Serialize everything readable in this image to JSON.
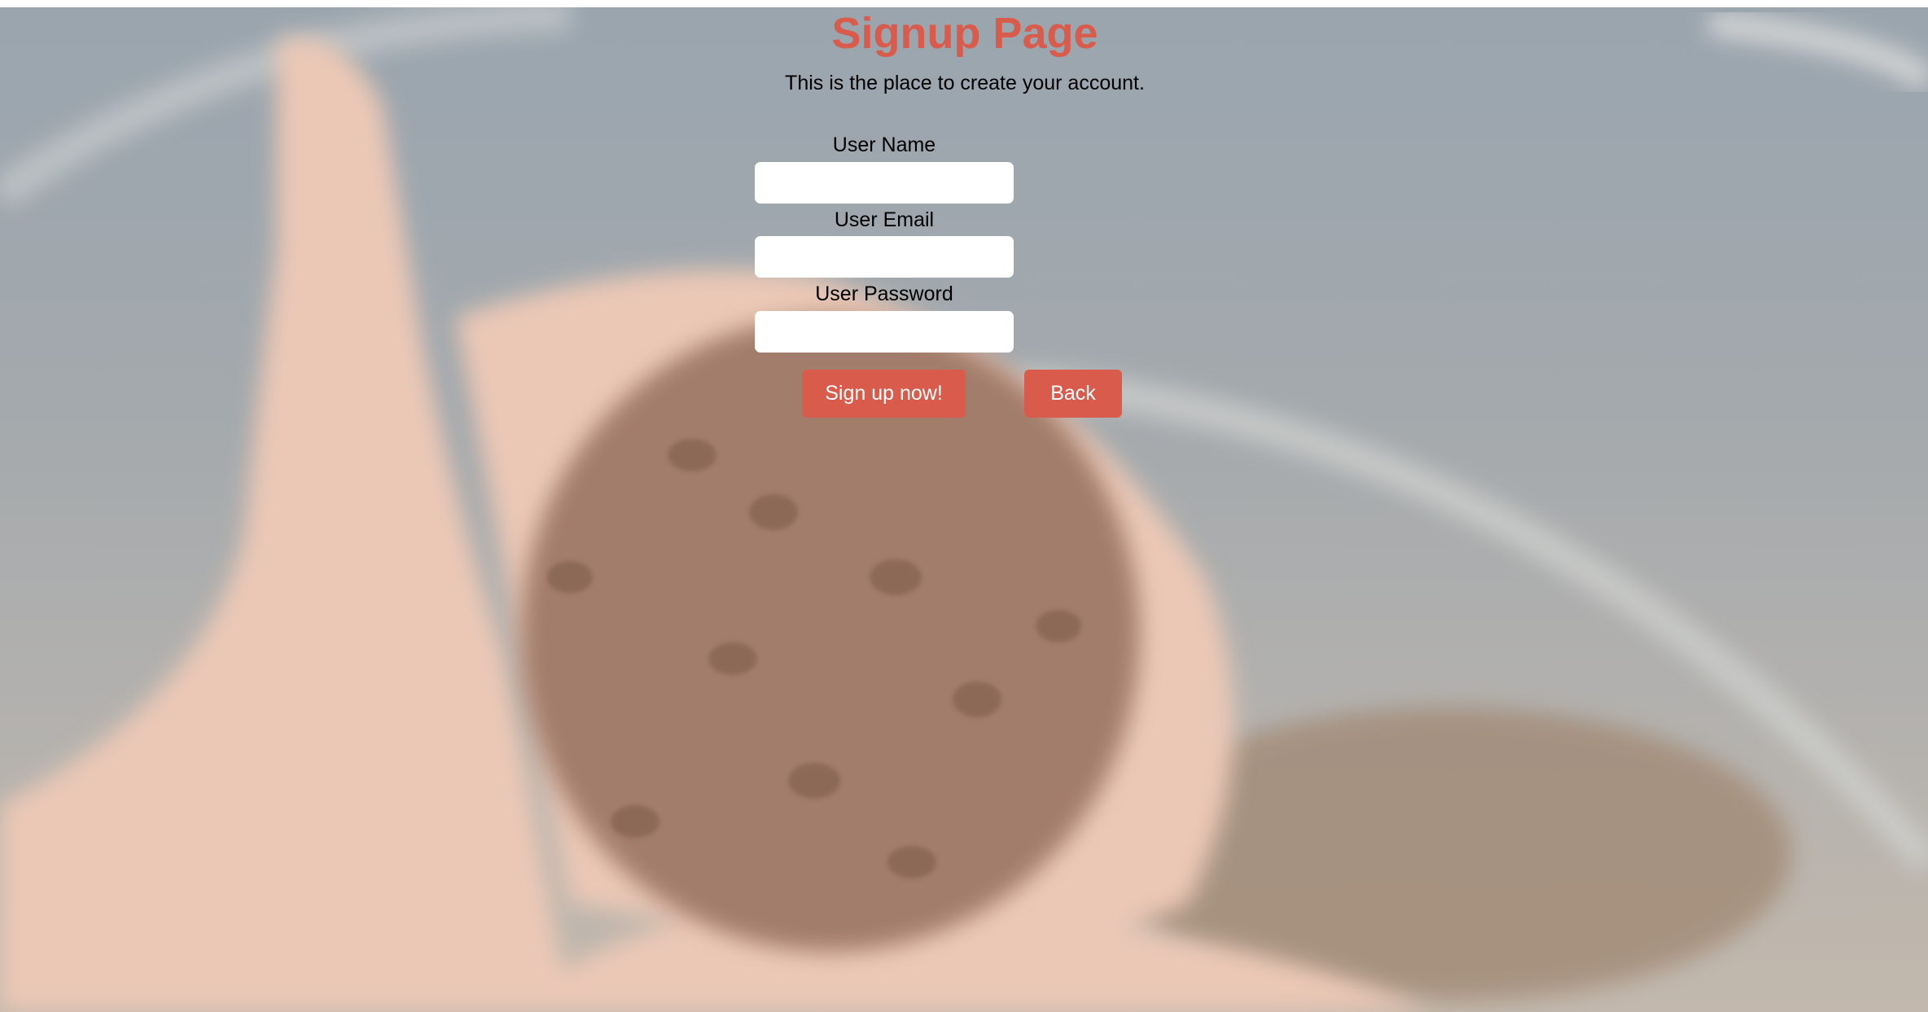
{
  "header": {
    "title": "Signup Page",
    "subtitle": "This is the place to create your account."
  },
  "form": {
    "username_label": "User Name",
    "username_value": "",
    "email_label": "User Email",
    "email_value": "",
    "password_label": "User Password",
    "password_value": "",
    "signup_button": "Sign up now!",
    "back_button": "Back"
  },
  "colors": {
    "accent": "#d95b4b"
  }
}
